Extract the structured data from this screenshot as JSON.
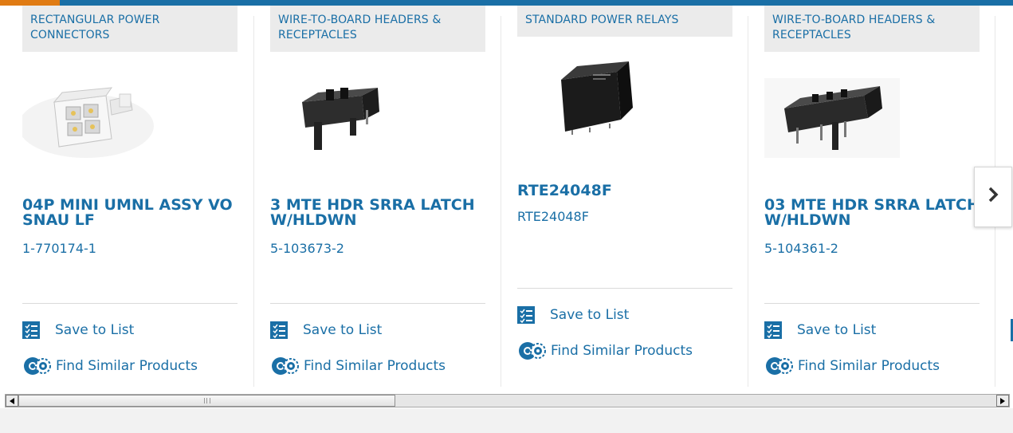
{
  "products": [
    {
      "category": "RECTANGULAR POWER CONNECTORS",
      "title": "04P MINI UMNL ASSY VO SNAU LF",
      "part_number": "1-770174-1",
      "image": "white-rectangular-connector-image",
      "save_label": "Save to List",
      "similar_label": "Find Similar Products"
    },
    {
      "category": "WIRE-TO-BOARD HEADERS & RECEPTACLES",
      "title": "3 MTE HDR SRRA LATCH W/HLDWN",
      "part_number": "5-103673-2",
      "image": "black-header-image",
      "save_label": "Save to List",
      "similar_label": "Find Similar Products"
    },
    {
      "category": "STANDARD POWER RELAYS",
      "title": "RTE24048F",
      "part_number": "RTE24048F",
      "image": "black-relay-image",
      "save_label": "Save to List",
      "similar_label": "Find Similar Products"
    },
    {
      "category": "WIRE-TO-BOARD HEADERS & RECEPTACLES",
      "title": "03 MTE HDR SRRA LATCH W/HLDWN",
      "part_number": "5-104361-2",
      "image": "black-header-image",
      "save_label": "Save to List",
      "similar_label": "Find Similar Products"
    }
  ],
  "carousel": {
    "next_icon": "chevron-right-icon"
  },
  "colors": {
    "link": "#1a6fa6",
    "accent": "#e07b13",
    "badge_bg": "#ebebeb"
  }
}
